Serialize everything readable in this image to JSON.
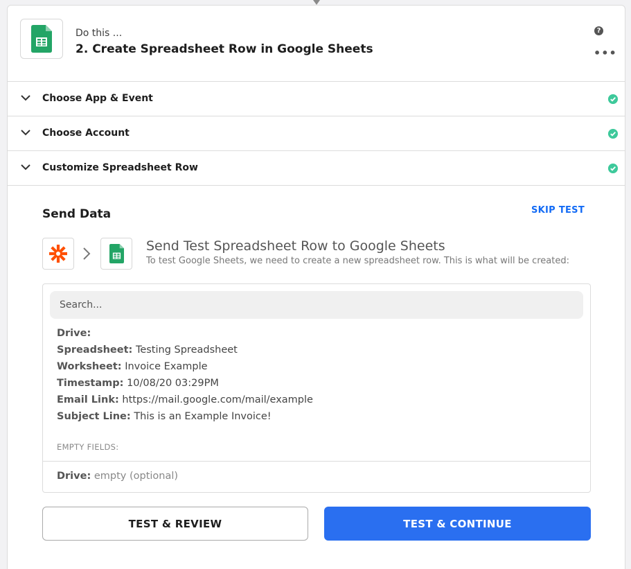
{
  "step": {
    "prefix": "Do this ...",
    "title": "2. Create Spreadsheet Row in Google Sheets",
    "app_icon": "google-sheets-icon"
  },
  "header_actions": {
    "help_icon": "?",
    "more_icon": "•••"
  },
  "sections": [
    {
      "label": "Choose App & Event",
      "complete": true
    },
    {
      "label": "Choose Account",
      "complete": true
    },
    {
      "label": "Customize Spreadsheet Row",
      "complete": true
    }
  ],
  "send_data": {
    "title": "Send Data",
    "skip_label": "SKIP TEST",
    "heading": "Send Test Spreadsheet Row to Google Sheets",
    "subtitle": "To test Google Sheets, we need to create a new spreadsheet row. This is what will be created:",
    "source_icon": "zapier-icon",
    "target_icon": "google-sheets-icon"
  },
  "search": {
    "placeholder": "Search..."
  },
  "fields": [
    {
      "label": "Drive:",
      "value": ""
    },
    {
      "label": "Spreadsheet:",
      "value": "Testing Spreadsheet"
    },
    {
      "label": "Worksheet:",
      "value": "Invoice Example"
    },
    {
      "label": "Timestamp:",
      "value": "10/08/20 03:29PM"
    },
    {
      "label": "Email Link:",
      "value": "https://mail.google.com/mail/example"
    },
    {
      "label": "Subject Line:",
      "value": "This is an Example Invoice!"
    }
  ],
  "empty_fields": {
    "header": "EMPTY FIELDS:",
    "items": [
      {
        "label": "Drive:",
        "value": "empty (optional)"
      }
    ]
  },
  "buttons": {
    "review": "TEST & REVIEW",
    "continue": "TEST & CONTINUE"
  },
  "colors": {
    "accent": "#136bf5",
    "primary_button": "#2a6ff0",
    "success": "#3ec99b",
    "sheets_green": "#23a566",
    "zapier_orange": "#ff4f00"
  }
}
